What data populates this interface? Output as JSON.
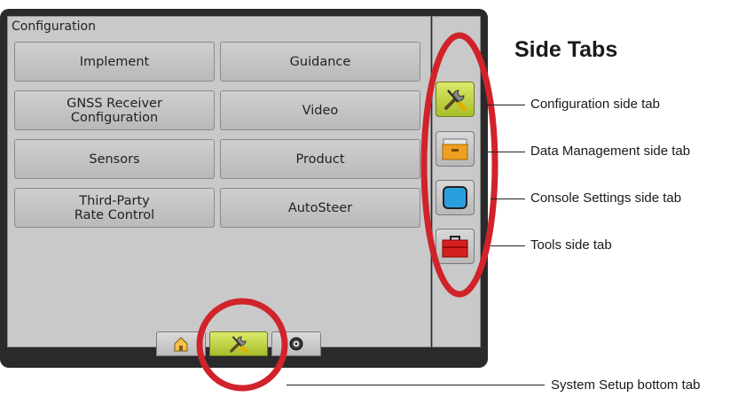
{
  "panel": {
    "title": "Configuration"
  },
  "buttons": {
    "implement": "Implement",
    "guidance": "Guidance",
    "gnss": "GNSS Receiver\nConfiguration",
    "video": "Video",
    "sensors": "Sensors",
    "product": "Product",
    "third_party": "Third-Party\nRate Control",
    "autosteer": "AutoSteer"
  },
  "side_tabs": [
    {
      "icon": "wrench-screwdriver-icon",
      "active": true
    },
    {
      "icon": "file-drawer-icon",
      "active": false
    },
    {
      "icon": "monitor-screen-icon",
      "active": false
    },
    {
      "icon": "toolbox-icon",
      "active": false
    }
  ],
  "bottom_tabs": [
    {
      "icon": "home-icon",
      "active": false
    },
    {
      "icon": "wrench-screwdriver-icon",
      "active": true
    },
    {
      "icon": "gauge-icon",
      "active": false
    }
  ],
  "annotations": {
    "heading": "Side Tabs",
    "configuration": "Configuration side tab",
    "data_management": "Data Management side tab",
    "console_settings": "Console Settings side tab",
    "tools": "Tools side tab",
    "system_setup": "System Setup bottom tab"
  },
  "colors": {
    "highlight_ring": "#d0232a",
    "active_tab": "#b7c93a",
    "device_bezel": "#2a2a2a"
  }
}
